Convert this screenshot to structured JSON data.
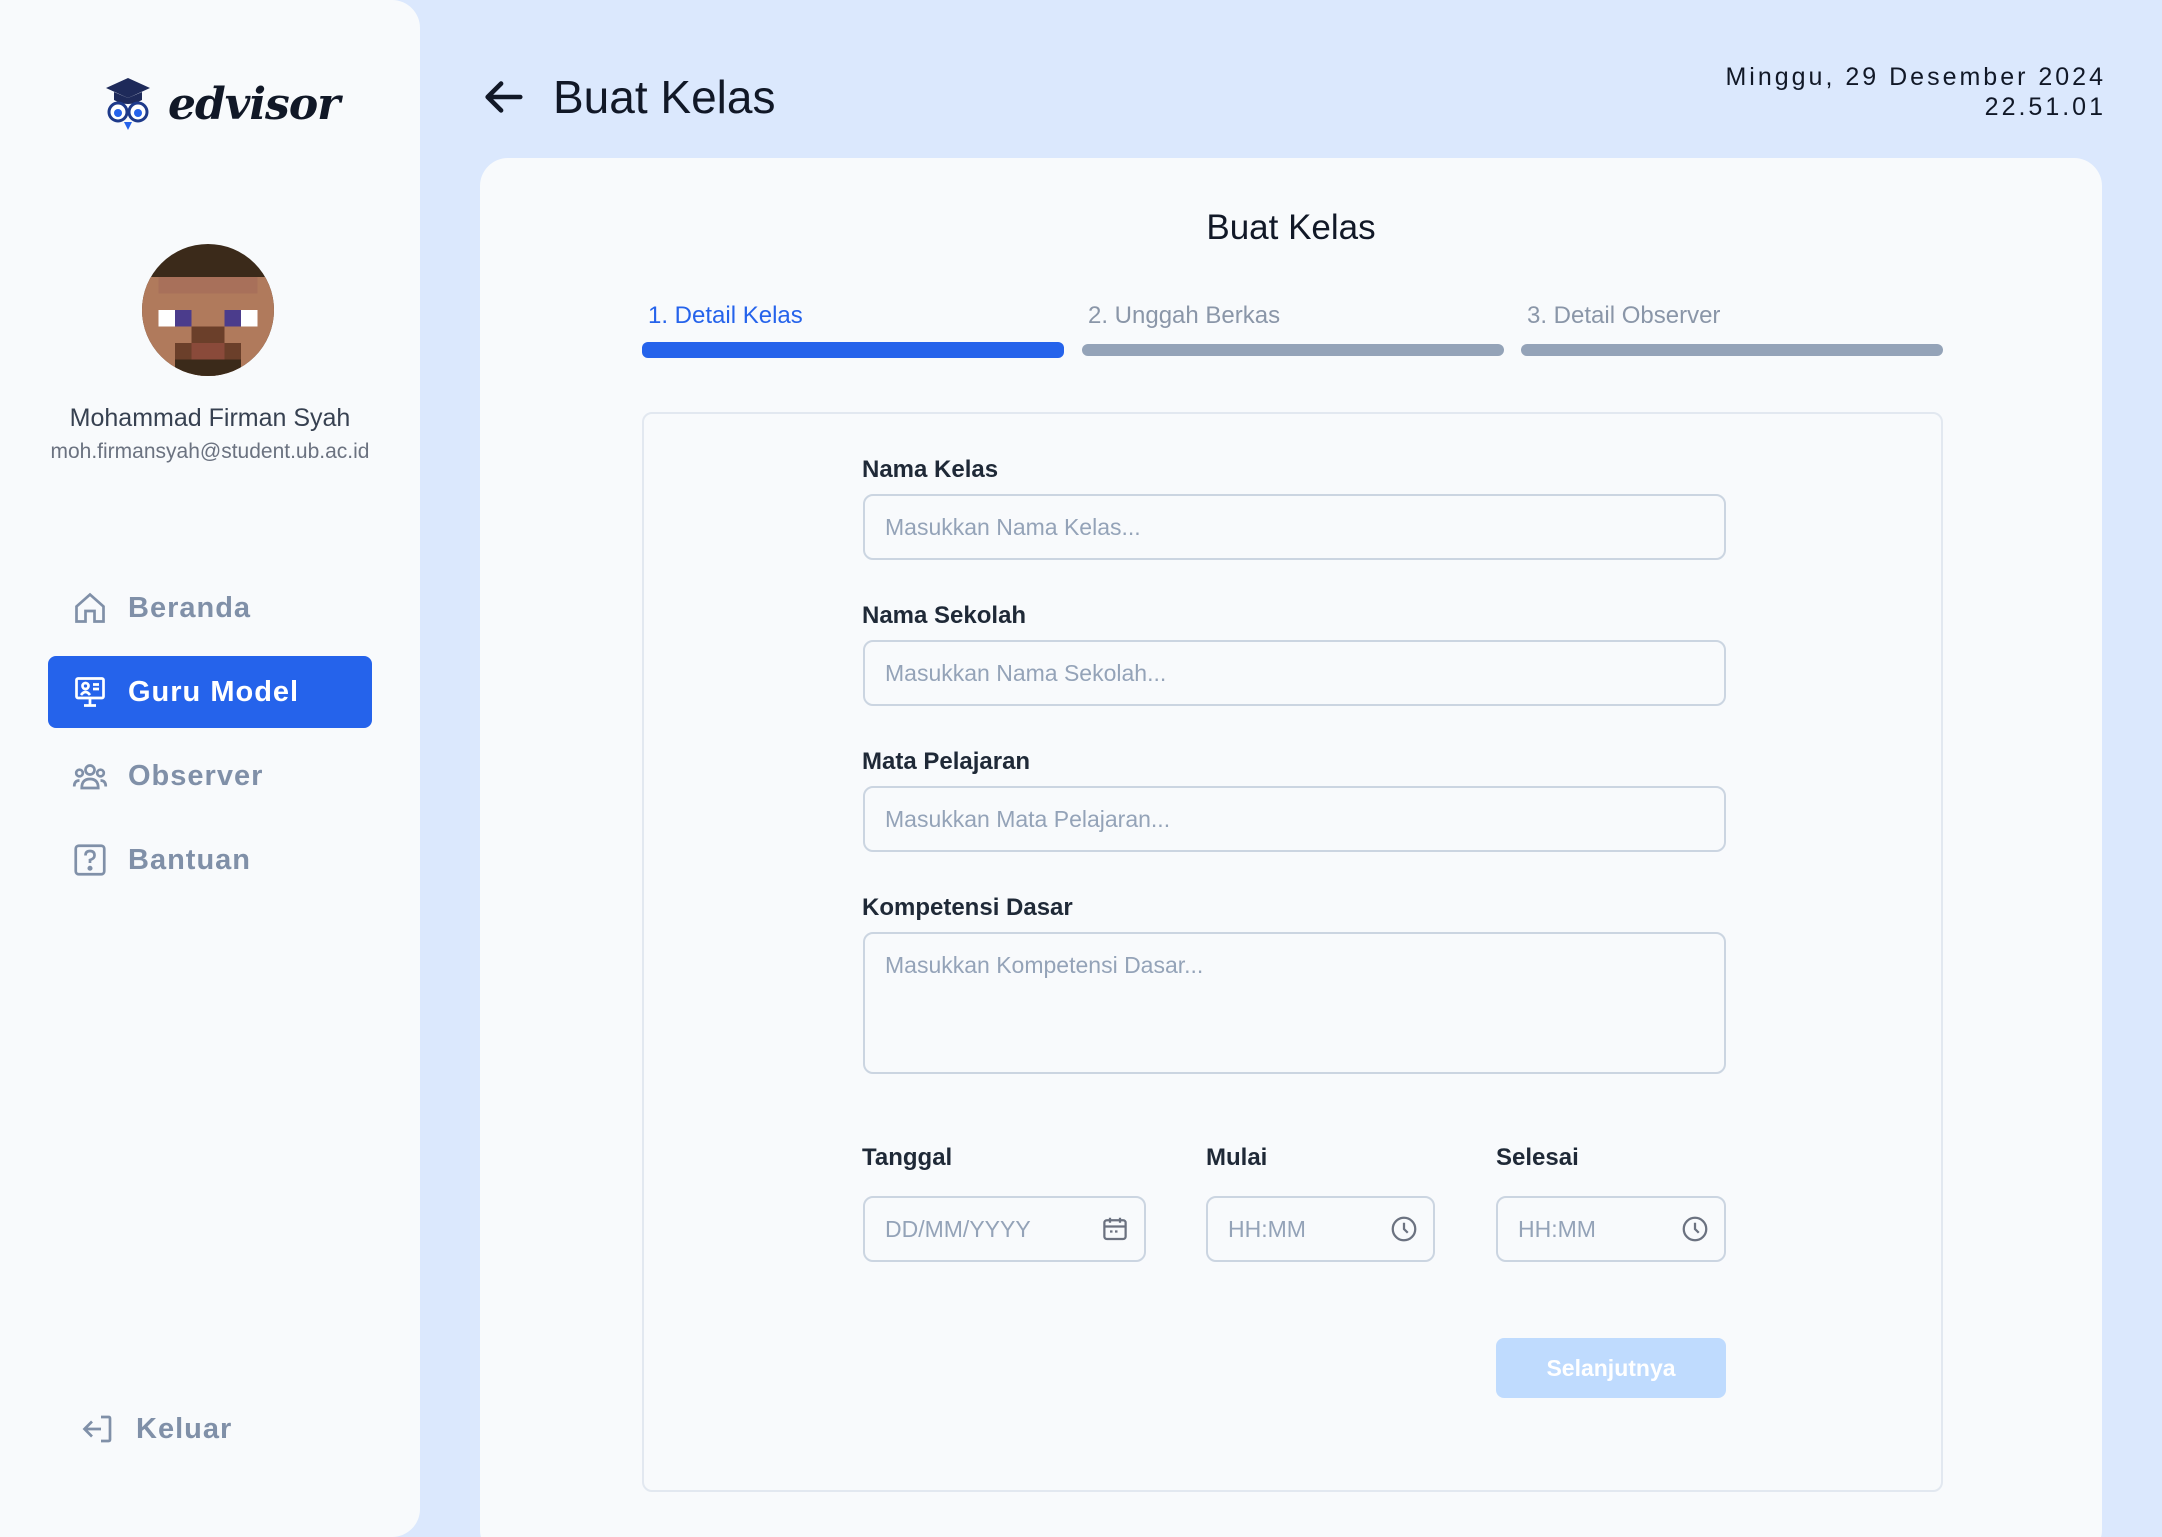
{
  "app": {
    "logo_text": "edvisor"
  },
  "user": {
    "name": "Mohammad Firman Syah",
    "email": "moh.firmansyah@student.ub.ac.id"
  },
  "sidebar": {
    "items": [
      {
        "label": "Beranda",
        "icon": "home-icon",
        "active": false
      },
      {
        "label": "Guru Model",
        "icon": "presentation-icon",
        "active": true
      },
      {
        "label": "Observer",
        "icon": "users-icon",
        "active": false
      },
      {
        "label": "Bantuan",
        "icon": "help-icon",
        "active": false
      }
    ],
    "logout_label": "Keluar"
  },
  "header": {
    "title": "Buat Kelas",
    "date": "Minggu, 29 Desember 2024",
    "time": "22.51.01"
  },
  "card": {
    "title": "Buat Kelas",
    "steps": [
      {
        "label": "1. Detail Kelas",
        "active": true
      },
      {
        "label": "2. Unggah Berkas",
        "active": false
      },
      {
        "label": "3. Detail Observer",
        "active": false
      }
    ]
  },
  "form": {
    "nama_kelas": {
      "label": "Nama Kelas",
      "placeholder": "Masukkan Nama Kelas..."
    },
    "nama_sekolah": {
      "label": "Nama Sekolah",
      "placeholder": "Masukkan Nama Sekolah..."
    },
    "mata_pelajaran": {
      "label": "Mata Pelajaran",
      "placeholder": "Masukkan Mata Pelajaran..."
    },
    "kompetensi_dasar": {
      "label": "Kompetensi Dasar",
      "placeholder": "Masukkan Kompetensi Dasar..."
    },
    "tanggal": {
      "label": "Tanggal",
      "placeholder": "DD/MM/YYYY"
    },
    "mulai": {
      "label": "Mulai",
      "placeholder": "HH:MM"
    },
    "selesai": {
      "label": "Selesai",
      "placeholder": "HH:MM"
    },
    "next_label": "Selanjutnya"
  },
  "colors": {
    "accent": "#2563eb",
    "background": "#dbe8fd",
    "disabled_button": "#bfdbfe"
  }
}
